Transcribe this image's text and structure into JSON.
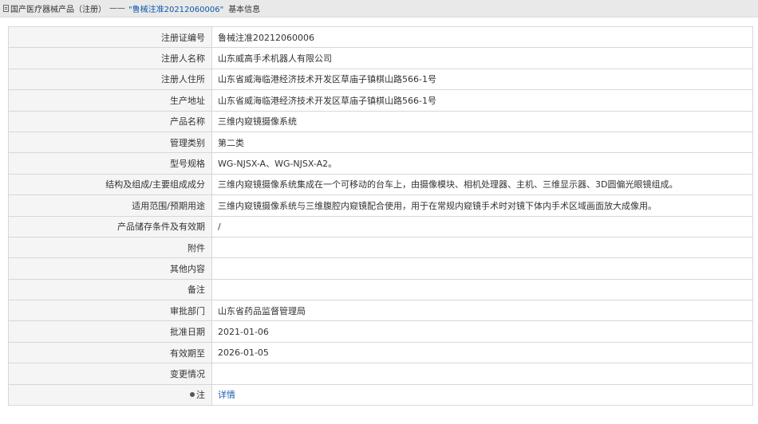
{
  "breadcrumb": {
    "root": "国产医疗器械产品（注册）",
    "separator": "——",
    "current": "\"鲁械注准20212060006\"",
    "tail": "基本信息"
  },
  "rows": [
    {
      "label": "注册证编号",
      "value": "鲁械注准20212060006"
    },
    {
      "label": "注册人名称",
      "value": "山东威高手术机器人有限公司"
    },
    {
      "label": "注册人住所",
      "value": "山东省威海临港经济技术开发区草庙子镇棋山路566-1号"
    },
    {
      "label": "生产地址",
      "value": "山东省威海临港经济技术开发区草庙子镇棋山路566-1号"
    },
    {
      "label": "产品名称",
      "value": "三维内窥镜摄像系统"
    },
    {
      "label": "管理类别",
      "value": "第二类"
    },
    {
      "label": "型号规格",
      "value": "WG-NJSX-A、WG-NJSX-A2。"
    },
    {
      "label": "结构及组成/主要组成成分",
      "value": "三维内窥镜摄像系统集成在一个可移动的台车上，由摄像模块、相机处理器、主机、三维显示器、3D圆偏光眼镜组成。"
    },
    {
      "label": "适用范围/预期用途",
      "value": "三维内窥镜摄像系统与三维腹腔内窥镜配合使用，用于在常规内窥镜手术时对镜下体内手术区域画面放大成像用。"
    },
    {
      "label": "产品储存条件及有效期",
      "value": "/"
    },
    {
      "label": "附件",
      "value": ""
    },
    {
      "label": "其他内容",
      "value": ""
    },
    {
      "label": "备注",
      "value": ""
    },
    {
      "label": "审批部门",
      "value": "山东省药品监督管理局"
    },
    {
      "label": "批准日期",
      "value": "2021-01-06"
    },
    {
      "label": "有效期至",
      "value": "2026-01-05"
    },
    {
      "label": "变更情况",
      "value": ""
    }
  ],
  "note_row": {
    "icon": "pin-icon",
    "label": "注",
    "link": "详情"
  }
}
